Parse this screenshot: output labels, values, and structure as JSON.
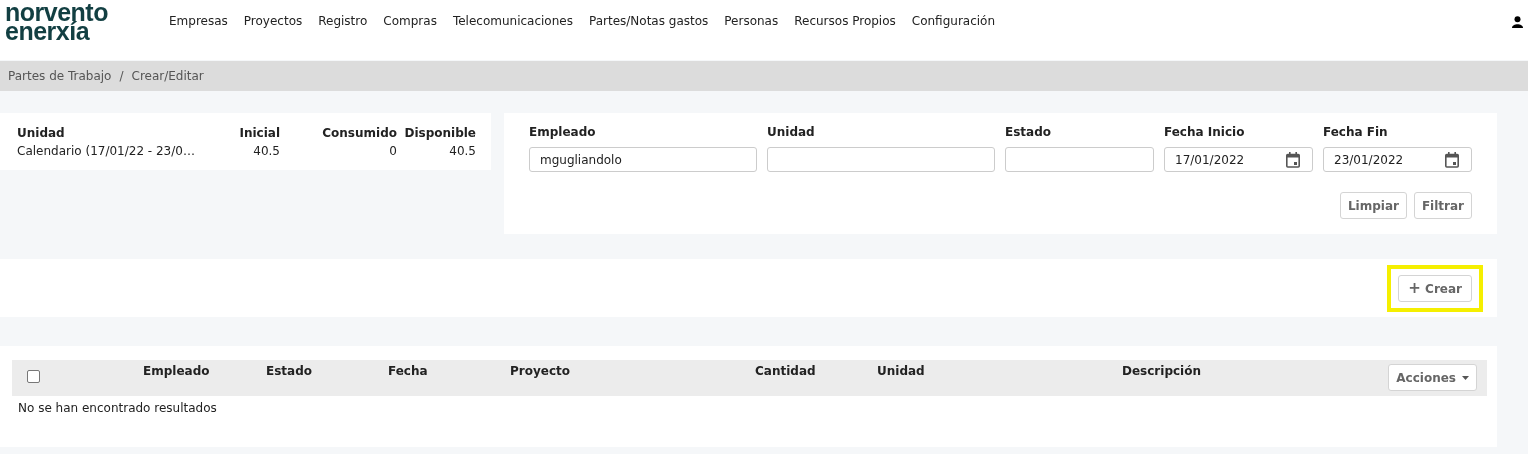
{
  "logo": {
    "lines": [
      "norvento",
      "enerxía"
    ]
  },
  "nav": {
    "items": [
      "Empresas",
      "Proyectos",
      "Registro",
      "Compras",
      "Telecomunicaciones",
      "Partes/Notas gastos",
      "Personas",
      "Recursos Propios",
      "Configuración"
    ]
  },
  "breadcrumb": [
    "Partes de Trabajo",
    "/",
    "Crear/Editar"
  ],
  "summary": {
    "columns": [
      "Unidad",
      "Inicial",
      "Consumido",
      "Disponible"
    ],
    "rows": [
      [
        "Calendario (17/01/22 - 23/0…",
        "40.5",
        "0",
        "40.5"
      ]
    ]
  },
  "filters": {
    "fields": [
      {
        "label": "Empleado",
        "value": "mgugliandolo",
        "kind": "text"
      },
      {
        "label": "Unidad",
        "kind": "text"
      },
      {
        "label": "Estado",
        "kind": "text"
      },
      {
        "label": "Fecha Inicio",
        "value": "17/01/2022",
        "kind": "date"
      },
      {
        "label": "Fecha Fin",
        "value": "23/01/2022",
        "kind": "date"
      }
    ],
    "buttons": [
      "Limpiar",
      "Filtrar"
    ]
  },
  "create": {
    "label": "Crear",
    "icon": "+",
    "highlighted": true
  },
  "table": {
    "select_all_checked": false,
    "columns": [
      "Empleado",
      "Estado",
      "Fecha",
      "Proyecto",
      "Cantidad",
      "Unidad",
      "Descripción"
    ],
    "actions": "Acciones",
    "empty": "No se han encontrado resultados"
  }
}
